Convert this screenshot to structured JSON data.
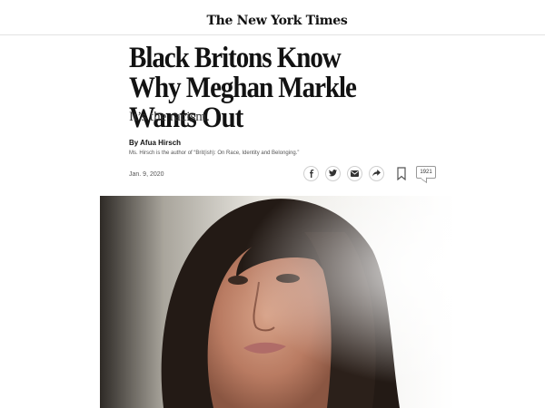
{
  "masthead": {
    "logo_text": "The New York Times"
  },
  "article": {
    "headline": "Black Britons Know Why Meghan Markle Wants Out",
    "summary": "It’s the racism.",
    "byline": "By Afua Hirsch",
    "author_note": "Ms. Hirsch is the author of “Brit(ish): On Race, Identity and Belonging.”",
    "date": "Jan. 9, 2020"
  },
  "share": {
    "icons": [
      "facebook-icon",
      "twitter-icon",
      "email-icon",
      "share-icon",
      "bookmark-icon",
      "comments-icon"
    ],
    "comment_count": "1921"
  },
  "photo": {
    "subject": "portrait-photo"
  }
}
